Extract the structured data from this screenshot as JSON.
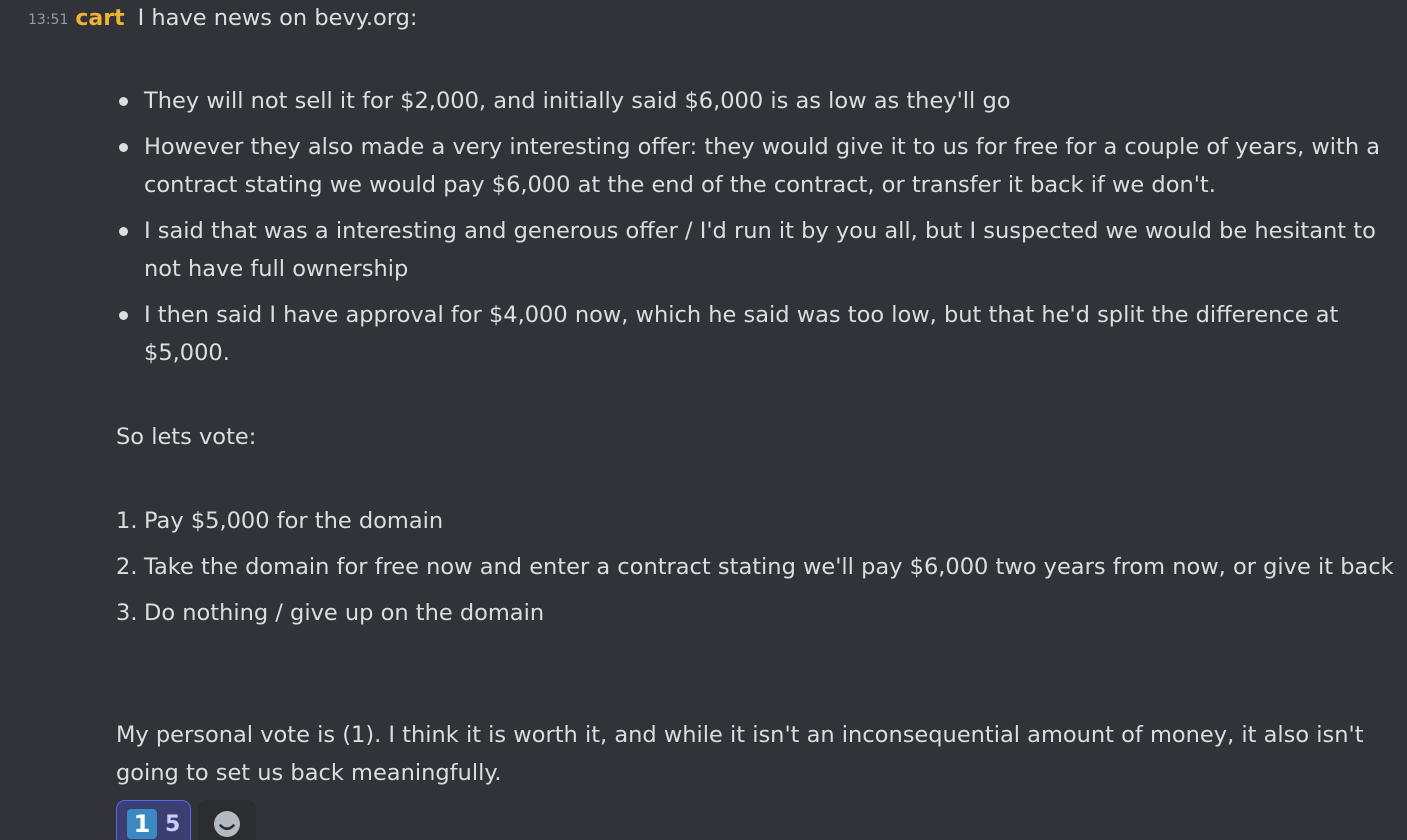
{
  "message": {
    "timestamp": "13:51",
    "author": "cart",
    "first_line": "I have news on bevy.org:",
    "bullets": [
      "They will not sell it for $2,000, and initially said $6,000 is as low as they'll go",
      "However they also made a very interesting offer: they would give it to us for free for a couple of years, with a contract stating we would pay $6,000 at the end of the contract, or transfer it back if we don't.",
      "I said that was a interesting and generous offer / I'd run it by you all, but I suspected we would be hesitant to not have full ownership",
      "I then said I have approval for $4,000 now, which he said was too low, but that he'd split the difference at $5,000."
    ],
    "vote_intro": "So lets vote:",
    "options": [
      {
        "num": "1.",
        "text": "Pay $5,000 for the domain"
      },
      {
        "num": "2.",
        "text": "Take the domain for free now and enter a contract stating we'll pay $6,000 two years from now, or give it back"
      },
      {
        "num": "3.",
        "text": "Do nothing / give up on the domain"
      }
    ],
    "closing": "My personal vote is (1). I think it is worth it, and while it isn't an inconsequential amount of money, it also isn't going to set us back meaningfully."
  },
  "reactions": [
    {
      "emoji": "1",
      "icon": "keycap-one-icon",
      "count": "5",
      "active": true
    }
  ],
  "add_reaction_icon": "smile-icon",
  "colors": {
    "background": "#313338",
    "text": "#dbdee1",
    "timestamp": "#949ba4",
    "username": "#f0b232",
    "reaction_active_bg": "#3b3e70",
    "reaction_active_border": "#5865f2",
    "keycap_blue": "#3b88c3"
  }
}
